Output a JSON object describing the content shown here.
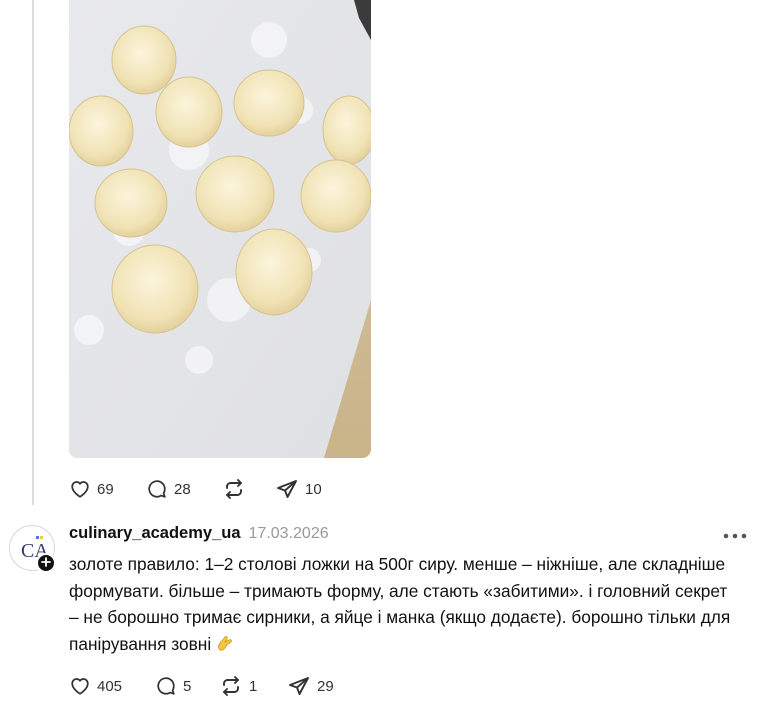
{
  "post1": {
    "image_alt": "Сирники перед смаженням на дошці",
    "likes": "69",
    "comments": "28",
    "reposts": "",
    "shares": "10"
  },
  "post2": {
    "username": "culinary_academy_ua",
    "date": "17.03.2026",
    "avatar_initials": "CA",
    "text": "золоте правило: 1–2 столові ложки на 500г сиру. менше – ніжніше, але складніше формувати. більше – тримають форму, але стають «забитими». і головний секрет – не борошно тримає сирники, а яйце і манка (якщо додаєте). борошно тільки для панірування зовні",
    "likes": "405",
    "comments": "5",
    "reposts": "1",
    "shares": "29"
  },
  "icons": [
    "heart-icon",
    "comment-icon",
    "repost-icon",
    "share-icon",
    "more-icon",
    "plus-icon",
    "pinching-hand-emoji"
  ],
  "colors": {
    "text": "#111111",
    "muted": "#999999",
    "icon": "#333333",
    "thread_line": "#dcdcdc"
  }
}
